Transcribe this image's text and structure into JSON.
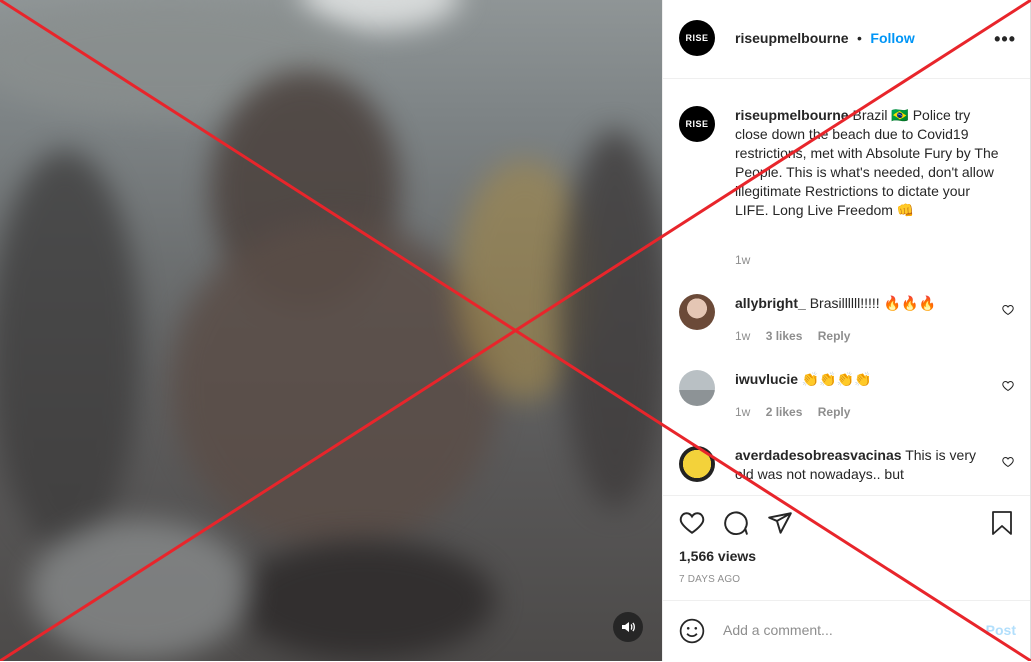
{
  "post": {
    "username": "riseupmelbourne",
    "avatar_text": "RISE",
    "separator": "•",
    "follow_label": "Follow",
    "more_icon": "more-options-icon",
    "caption_text": "Brazil 🇧🇷 Police try close down the beach due to Covid19 restrictions, met with Absolute Fury by The People. This is what's needed, don't allow illegitimate Restrictions to dictate your LIFE. Long Live Freedom 👊",
    "caption_time": "1w",
    "views": "1,566 views",
    "date": "7 DAYS AGO"
  },
  "comments": [
    {
      "username": "allybright_",
      "text": "Brasillllll!!!!! 🔥🔥🔥",
      "time": "1w",
      "likes": "3 likes",
      "reply": "Reply"
    },
    {
      "username": "iwuvlucie",
      "text": "👏👏👏👏",
      "time": "1w",
      "likes": "2 likes",
      "reply": "Reply"
    },
    {
      "username": "averdadesobreasvacinas",
      "text": "This is very old was not nowadays.. but",
      "time": "",
      "likes": "",
      "reply": ""
    }
  ],
  "composer": {
    "placeholder": "Add a comment...",
    "post_label": "Post"
  },
  "colors": {
    "link": "#0095f6",
    "cross": "#e8252b",
    "post_disabled": "#b2dffc"
  }
}
